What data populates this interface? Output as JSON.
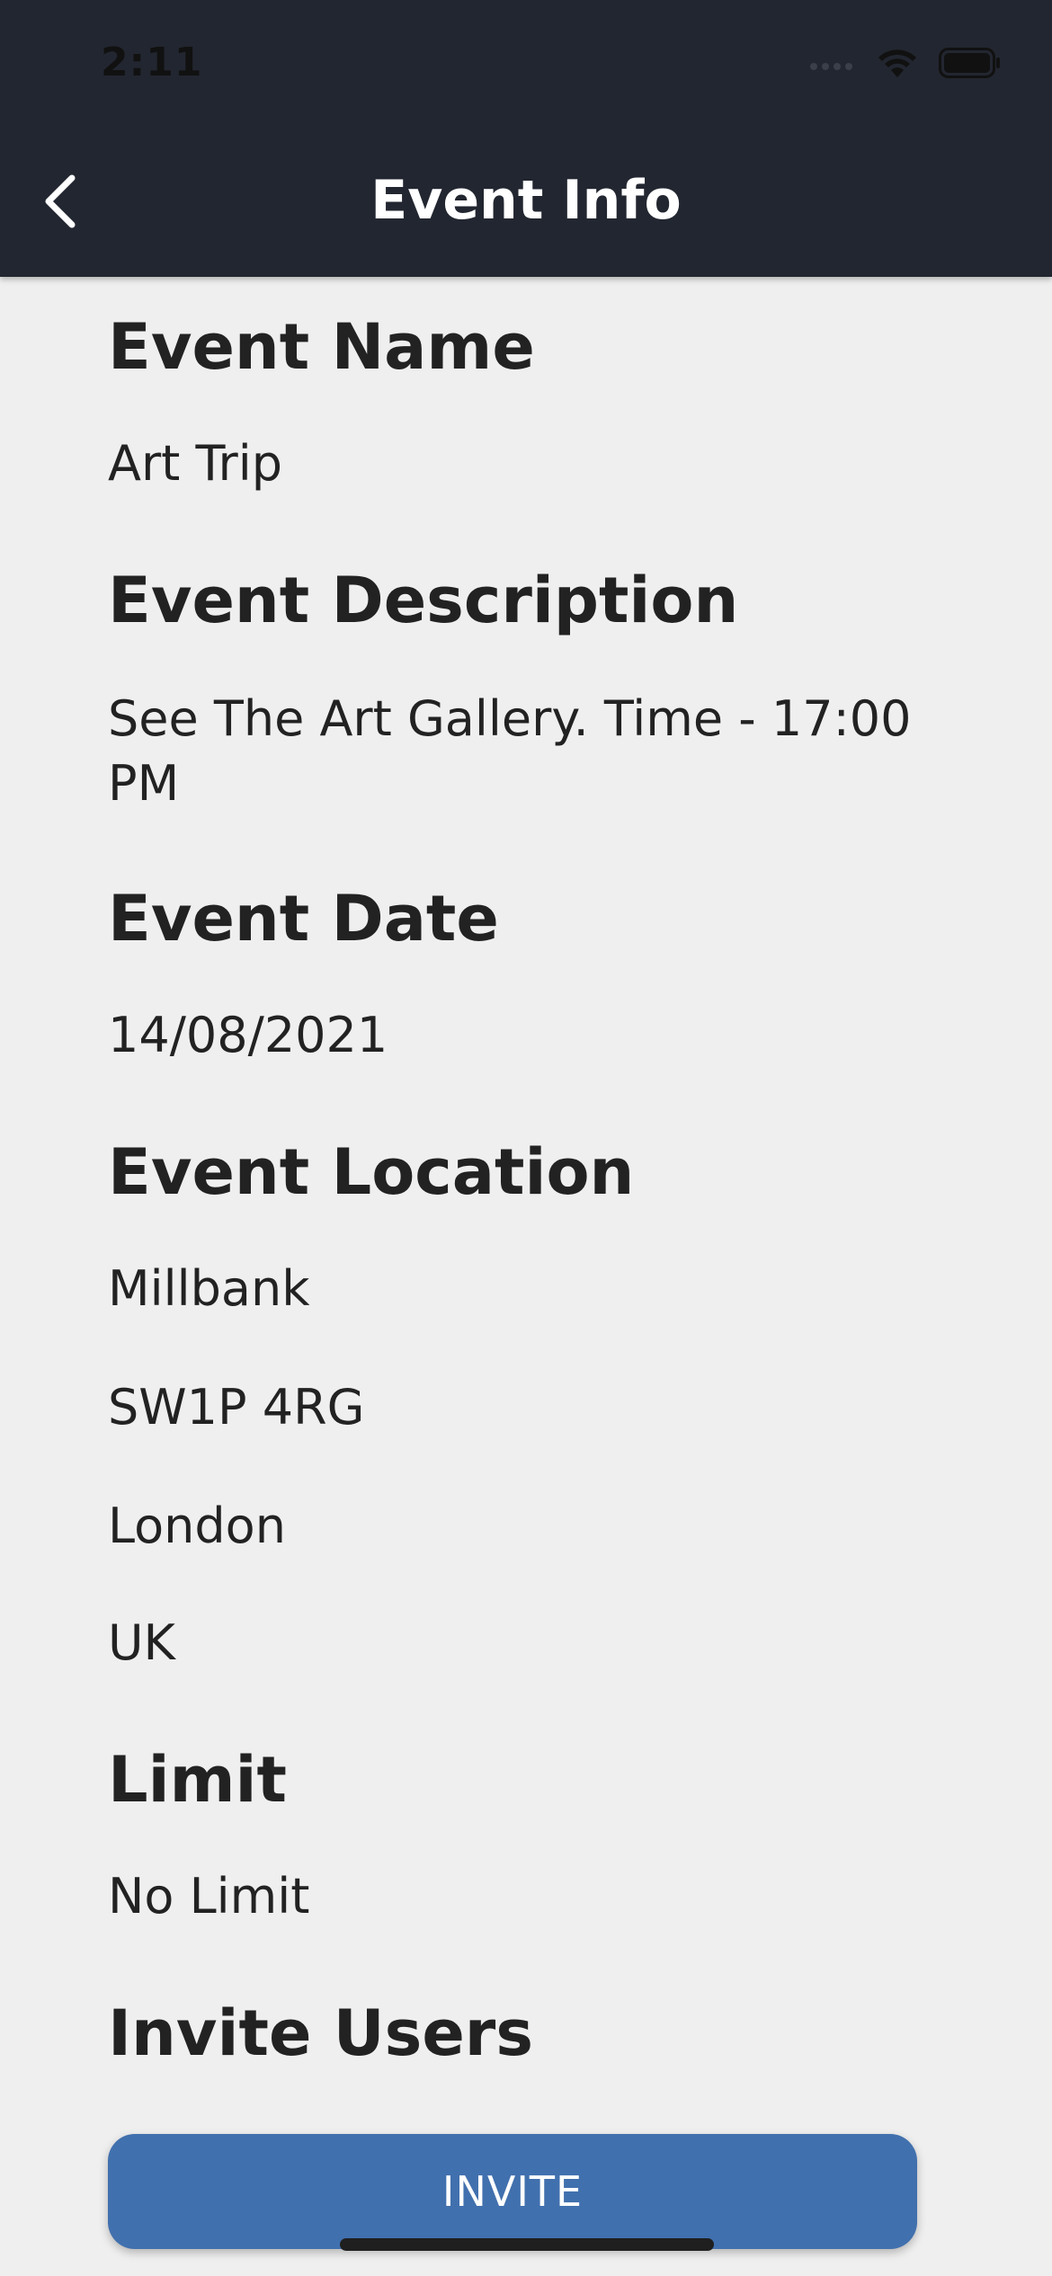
{
  "status_bar": {
    "time": "2:11",
    "icons": [
      "signal-icon",
      "wifi-icon",
      "battery-icon"
    ]
  },
  "nav": {
    "title": "Event Info",
    "back_icon": "chevron-left-icon"
  },
  "sections": {
    "name": {
      "heading": "Event Name",
      "value": "Art Trip"
    },
    "description": {
      "heading": "Event Description",
      "value": "See The Art Gallery. Time - 17:00 PM"
    },
    "date": {
      "heading": "Event Date",
      "value": "14/08/2021"
    },
    "location": {
      "heading": "Event Location",
      "lines": [
        "Millbank",
        "SW1P 4RG",
        "London",
        "UK"
      ]
    },
    "limit": {
      "heading": "Limit",
      "value": "No Limit"
    },
    "invite": {
      "heading": "Invite Users",
      "button_label": "INVITE"
    }
  },
  "colors": {
    "header_bg": "#222630",
    "page_bg": "#efefef",
    "accent": "#4170ae",
    "text": "#222222"
  }
}
